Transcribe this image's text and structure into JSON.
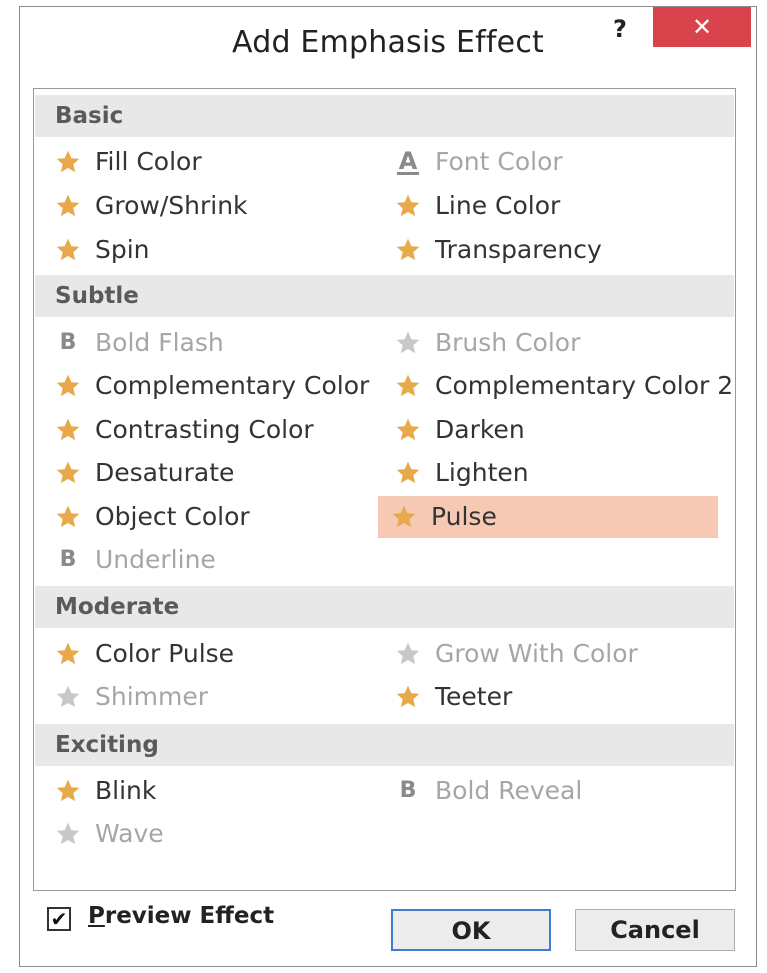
{
  "dialog": {
    "title": "Add Emphasis Effect",
    "help_label": "?",
    "close_label": "✕"
  },
  "categories": [
    {
      "name": "Basic"
    },
    {
      "name": "Subtle"
    },
    {
      "name": "Moderate"
    },
    {
      "name": "Exciting"
    }
  ],
  "effects": {
    "fill_color": {
      "label": "Fill Color",
      "icon": "star-icon",
      "enabled": true
    },
    "font_color": {
      "label": "Font Color",
      "icon": "font-a-icon",
      "enabled": false
    },
    "grow_shrink": {
      "label": "Grow/Shrink",
      "icon": "star-icon",
      "enabled": true
    },
    "line_color": {
      "label": "Line Color",
      "icon": "star-icon",
      "enabled": true
    },
    "spin": {
      "label": "Spin",
      "icon": "star-icon",
      "enabled": true
    },
    "transparency": {
      "label": "Transparency",
      "icon": "star-icon",
      "enabled": true
    },
    "bold_flash": {
      "label": "Bold Flash",
      "icon": "bold-b-icon",
      "enabled": false
    },
    "brush_color": {
      "label": "Brush Color",
      "icon": "star-icon",
      "enabled": false
    },
    "complementary_color": {
      "label": "Complementary Color",
      "icon": "star-icon",
      "enabled": true
    },
    "complementary_color_2": {
      "label": "Complementary Color 2",
      "icon": "star-icon",
      "enabled": true
    },
    "contrasting_color": {
      "label": "Contrasting Color",
      "icon": "star-icon",
      "enabled": true
    },
    "darken": {
      "label": "Darken",
      "icon": "star-icon",
      "enabled": true
    },
    "desaturate": {
      "label": "Desaturate",
      "icon": "star-icon",
      "enabled": true
    },
    "lighten": {
      "label": "Lighten",
      "icon": "star-icon",
      "enabled": true
    },
    "object_color": {
      "label": "Object Color",
      "icon": "star-icon",
      "enabled": true
    },
    "pulse": {
      "label": "Pulse",
      "icon": "star-icon",
      "enabled": true,
      "selected": true
    },
    "underline": {
      "label": "Underline",
      "icon": "bold-b-icon",
      "enabled": false
    },
    "color_pulse": {
      "label": "Color Pulse",
      "icon": "star-icon",
      "enabled": true
    },
    "grow_with_color": {
      "label": "Grow With Color",
      "icon": "star-icon",
      "enabled": false
    },
    "shimmer": {
      "label": "Shimmer",
      "icon": "star-icon",
      "enabled": false
    },
    "teeter": {
      "label": "Teeter",
      "icon": "star-icon",
      "enabled": true
    },
    "blink": {
      "label": "Blink",
      "icon": "star-icon",
      "enabled": true
    },
    "bold_reveal": {
      "label": "Bold Reveal",
      "icon": "bold-b-icon",
      "enabled": false
    },
    "wave": {
      "label": "Wave",
      "icon": "star-icon",
      "enabled": false
    }
  },
  "footer": {
    "preview_checked": true,
    "preview_label_underlined": "P",
    "preview_label_rest": "review Effect",
    "ok_label": "OK",
    "cancel_label": "Cancel"
  },
  "colors": {
    "star_enabled": "#e8a94a",
    "star_disabled": "#c8c8c8",
    "selected_bg": "#f6c9b4",
    "close_bg": "#d9434b",
    "ok_border": "#3c7fc8"
  }
}
